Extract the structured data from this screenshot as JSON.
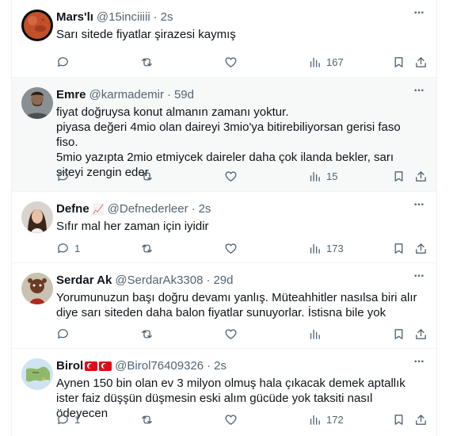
{
  "tweets": [
    {
      "name": "Mars'lı",
      "handle": "@15inciiiii",
      "sep": "·",
      "time": "2s",
      "text": "Sarı sitede fiyatlar şirazesi kaymış",
      "replies": "",
      "reposts": "",
      "likes": "",
      "views": "167",
      "avatar_icon": "planet-mars-avatar"
    },
    {
      "name": "Emre",
      "handle": "@karmademir",
      "sep": "·",
      "time": "59d",
      "text": "fiyat doğruysa konut almanın zamanı yoktur.\npiyasa değeri 4mio olan daireyi 3mio'ya bitirebiliyorsan gerisi faso fiso.\n5mio yazıpta 2mio etmiycek daireler daha çok ilanda bekler, sarı siteyi zengin eder.",
      "replies": "",
      "reposts": "",
      "likes": "",
      "views": "15",
      "avatar_icon": "man-photo-avatar"
    },
    {
      "name": "Defne",
      "handle": "@Defnederleer",
      "sep": "·",
      "time": "2s",
      "text": "Sıfır mal her zaman için iyidir",
      "replies": "1",
      "reposts": "",
      "likes": "",
      "views": "173",
      "avatar_icon": "woman-photo-avatar",
      "name_badge": "📈"
    },
    {
      "name": "Serdar Ak",
      "handle": "@SerdarAk3308",
      "sep": "·",
      "time": "29d",
      "text": "Yorumunuzun başı doğru devamı yanlış. Müteahhitler nasılsa biri alır diye sarı siteden daha balon fiyatlar sunuyorlar. İstisna bile yok",
      "replies": "",
      "reposts": "",
      "likes": "",
      "views": "",
      "avatar_icon": "character-avatar"
    },
    {
      "name": "Birol",
      "handle": "@Birol76409326",
      "sep": "·",
      "time": "2s",
      "text": "Aynen 150 bin olan ev 3 milyon olmuş hala çıkacak demek aptallık ister faiz düşşün düşmesin eski alım gücüde yok taksiti nasıl ödeyecen",
      "replies": "1",
      "reposts": "",
      "likes": "",
      "views": "172",
      "avatar_icon": "map-avatar"
    }
  ],
  "colors": {
    "text": "#0f1419",
    "secondary": "#536471",
    "border": "#eff3f4",
    "highlight_bg": "#f7f9f9",
    "flag_red": "#e30a17"
  }
}
